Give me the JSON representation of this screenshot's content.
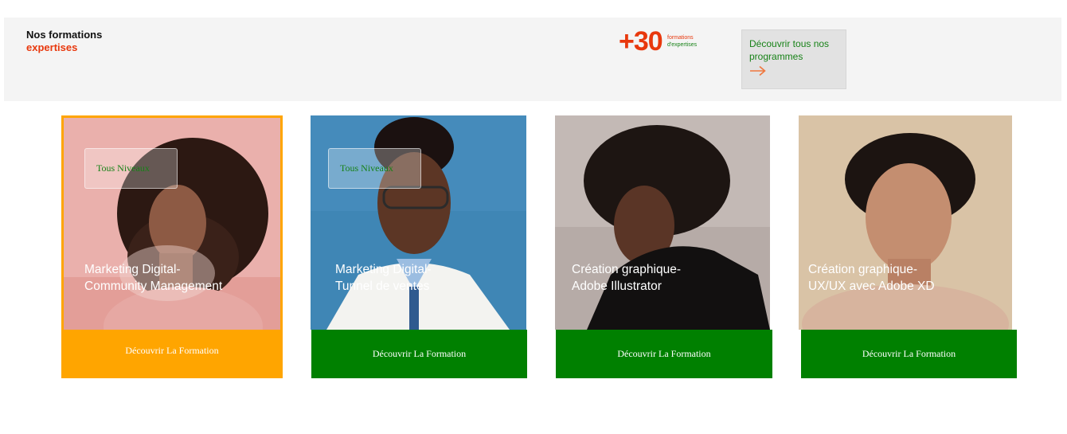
{
  "header": {
    "title_line1": "Nos formations",
    "title_line2": "expertises",
    "stat_number": "+30",
    "stat_label1": "formations",
    "stat_label2": "d'expertises",
    "cta_label": "Découvrir tous nos programmes",
    "cta_icon": "arrow-right-icon"
  },
  "colors": {
    "accent_red": "#e8380d",
    "accent_green": "#178217",
    "active_card": "#ffa500",
    "button_green": "#008000"
  },
  "cards": [
    {
      "badge": "Tous Niveaux",
      "title_line1": "Marketing Digital-",
      "title_line2": "Community Management",
      "button": "Découvrir La Formation",
      "active": true
    },
    {
      "badge": "Tous Niveaux",
      "title_line1": "Marketing Digital-",
      "title_line2": "Tunnel de ventes",
      "button": "Découvrir La Formation",
      "active": false
    },
    {
      "title_line1": "Création graphique-",
      "title_line2": "Adobe Illustrator",
      "button": "Découvrir La Formation",
      "active": false
    },
    {
      "title_line1": "Création graphique-",
      "title_line2": "UX/UX avec Adobe XD",
      "button": "Découvrir La Formation",
      "active": false
    }
  ]
}
